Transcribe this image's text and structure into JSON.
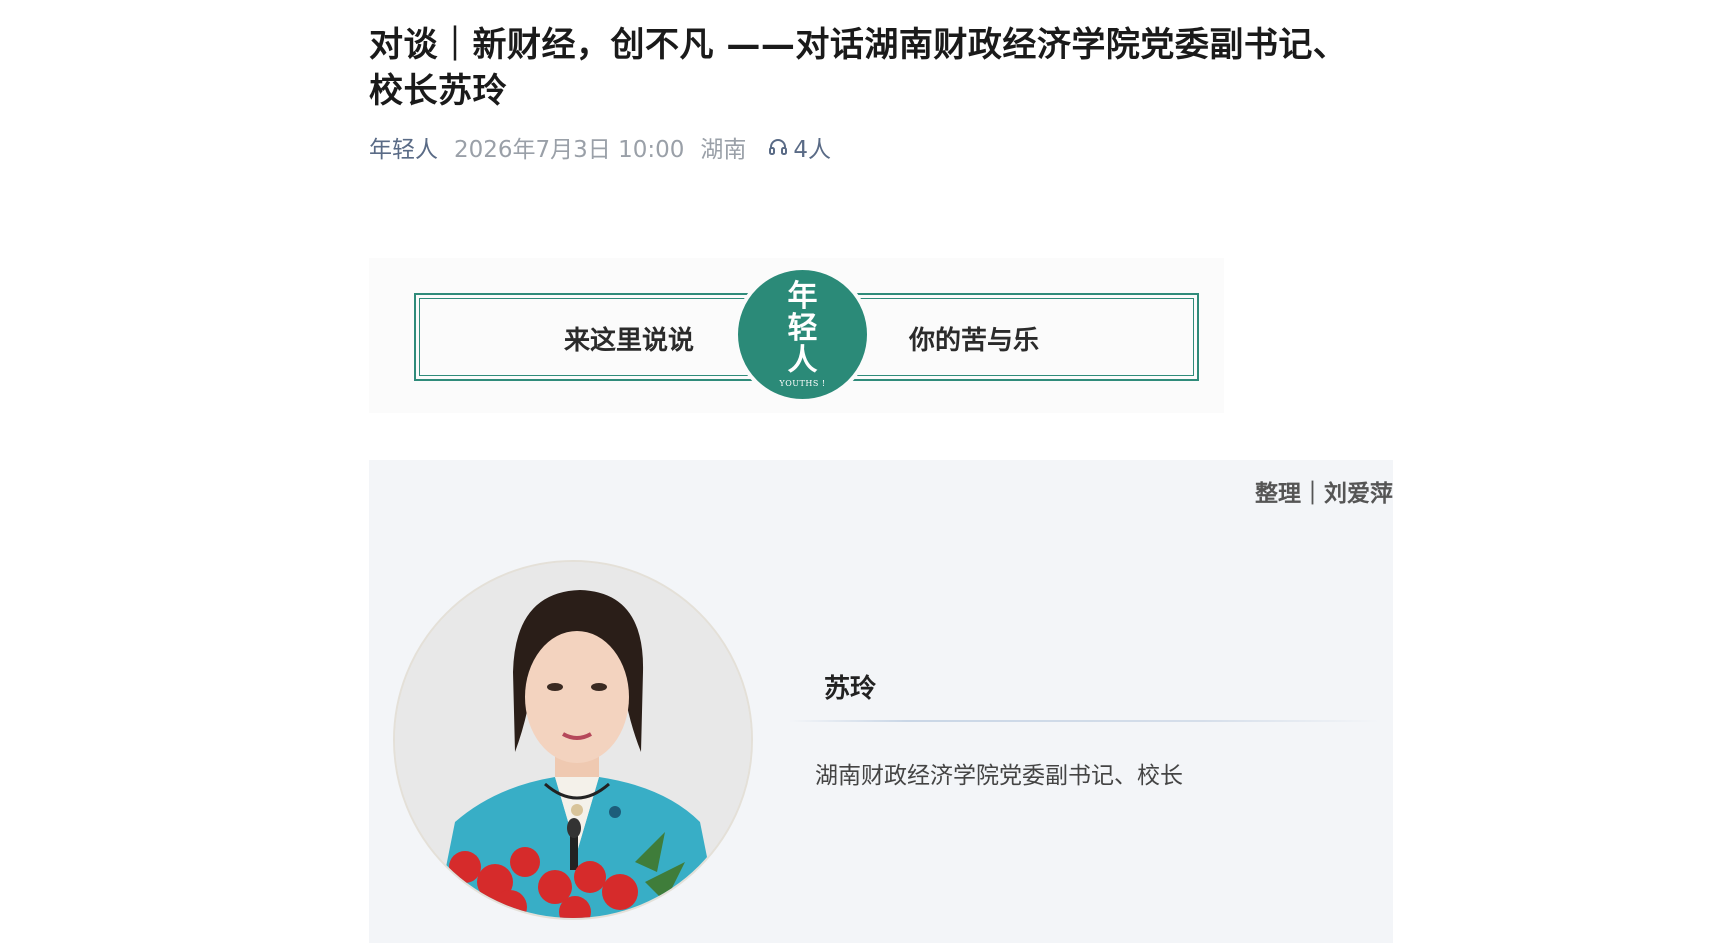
{
  "article": {
    "title": "对谈｜新财经，创不凡 ——对话湖南财政经济学院党委副书记、校长苏玲",
    "meta": {
      "author": "年轻人",
      "date": "2026年7月3日 10:00",
      "region": "湖南",
      "listens": "4人",
      "listens_icon": "headphones-icon"
    }
  },
  "banner": {
    "left_text": "来这里说说",
    "right_text": "你的苦与乐",
    "circle_text": "年轻人",
    "circle_sub": "YOUTHS !",
    "accent": "#2b8a78"
  },
  "profile": {
    "credit": "整理｜刘爱萍",
    "name": "苏玲",
    "position": "湖南财政经济学院党委副书记、校长"
  }
}
